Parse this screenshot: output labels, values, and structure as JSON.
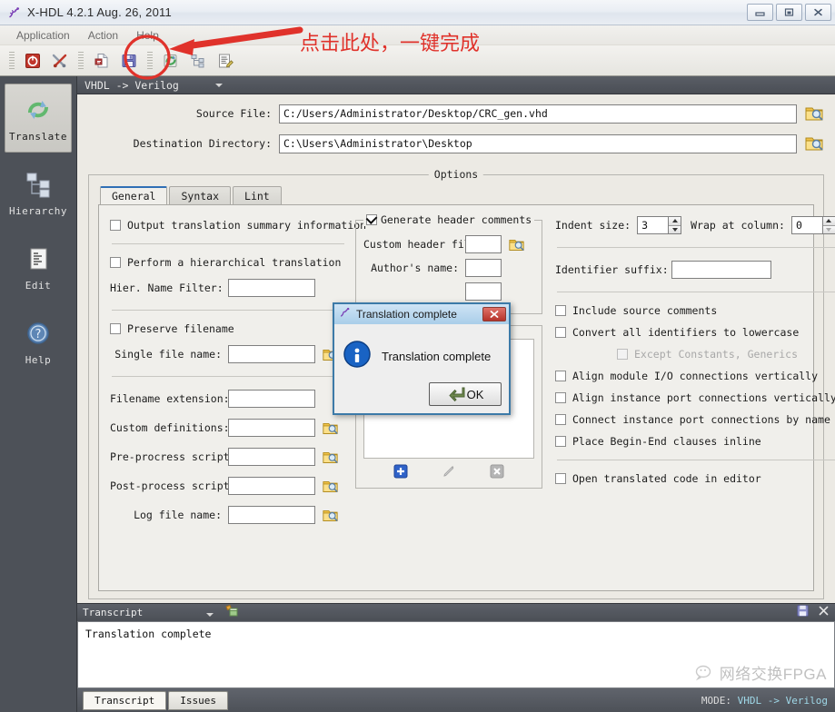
{
  "window": {
    "title": "X-HDL 4.2.1  Aug. 26, 2011",
    "app_icon": "gecko-icon",
    "minimize_label": "Minimize",
    "maximize_label": "Maximize",
    "close_label": "Close"
  },
  "menubar": {
    "items": [
      {
        "label": "Application"
      },
      {
        "label": "Action"
      },
      {
        "label": "Help"
      }
    ]
  },
  "toolbar": {
    "buttons": [
      {
        "name": "exit-icon",
        "title": "Exit"
      },
      {
        "name": "tools-icon",
        "title": "Tools"
      },
      {
        "name": "open-file-icon",
        "title": "Open"
      },
      {
        "name": "save-icon",
        "title": "Save"
      },
      {
        "name": "translate-icon",
        "title": "Translate"
      },
      {
        "name": "hierarchy-icon",
        "title": "Hierarchy"
      },
      {
        "name": "edit-icon",
        "title": "Edit"
      }
    ]
  },
  "sidebar": {
    "items": [
      {
        "label": "Translate",
        "icon": "translate-icon",
        "selected": true
      },
      {
        "label": "Hierarchy",
        "icon": "hierarchy-icon",
        "selected": false
      },
      {
        "label": "Edit",
        "icon": "edit-document-icon",
        "selected": false
      },
      {
        "label": "Help",
        "icon": "help-question-icon",
        "selected": false
      }
    ]
  },
  "mode_selector": {
    "value": "VHDL -> Verilog"
  },
  "form": {
    "source_file": {
      "label": "Source File:",
      "value": "C:/Users/Administrator/Desktop/CRC_gen.vhd",
      "browse_label": "Browse"
    },
    "destination_directory": {
      "label": "Destination Directory:",
      "value": "C:\\Users\\Administrator\\Desktop",
      "browse_label": "Browse"
    }
  },
  "options": {
    "group_title": "Options",
    "tabs": [
      {
        "label": "General",
        "active": true
      },
      {
        "label": "Syntax",
        "active": false
      },
      {
        "label": "Lint",
        "active": false
      }
    ],
    "left_column": {
      "checkboxes": [
        {
          "label": "Output translation summary information",
          "checked": false,
          "disabled": false
        },
        {
          "label": "Perform a hierarchical translation",
          "checked": false,
          "disabled": false
        },
        {
          "label": "Preserve filename",
          "checked": false,
          "disabled": false
        }
      ],
      "fields": [
        {
          "label": "Hier. Name Filter:",
          "value": "",
          "has_browse": false
        },
        {
          "label": "Single file name:",
          "value": "",
          "has_browse": true
        },
        {
          "label": "Filename extension:",
          "value": "",
          "has_browse": false
        },
        {
          "label": "Custom definitions:",
          "value": "",
          "has_browse": true
        },
        {
          "label": "Pre-procress script:",
          "value": "",
          "has_browse": true
        },
        {
          "label": "Post-process script:",
          "value": "",
          "has_browse": true
        },
        {
          "label": "Log file name:",
          "value": "",
          "has_browse": true
        }
      ]
    },
    "middle_column": {
      "group_checkbox": {
        "label": "Generate header comments",
        "checked": true
      },
      "fields": [
        {
          "label": "Custom header file:",
          "value": "",
          "has_browse": true
        },
        {
          "label": "Author's name:",
          "value": "",
          "has_browse": false
        }
      ],
      "list_items": [],
      "list_tools": [
        {
          "name": "add-icon",
          "label": "Add"
        },
        {
          "name": "edit-pencil-icon",
          "label": "Edit"
        },
        {
          "name": "delete-icon",
          "label": "Delete"
        }
      ]
    },
    "right_column": {
      "indent_size": {
        "label": "Indent size:",
        "value": "3"
      },
      "wrap_at_column": {
        "label": "Wrap at column:",
        "value": "0"
      },
      "identifier_suffix": {
        "label": "Identifier suffix:",
        "value": ""
      },
      "checkboxes": [
        {
          "label": "Include source comments",
          "checked": false,
          "disabled": false,
          "indent": false
        },
        {
          "label": "Convert all identifiers to lowercase",
          "checked": false,
          "disabled": false,
          "indent": false
        },
        {
          "label": "Except Constants, Generics",
          "checked": false,
          "disabled": true,
          "indent": true
        },
        {
          "label": "Align module I/O connections vertically",
          "checked": false,
          "disabled": false,
          "indent": false
        },
        {
          "label": "Align instance port connections vertically",
          "checked": false,
          "disabled": false,
          "indent": false
        },
        {
          "label": "Connect instance port connections by name",
          "checked": false,
          "disabled": false,
          "indent": false
        },
        {
          "label": "Place Begin-End clauses inline",
          "checked": false,
          "disabled": false,
          "indent": false
        },
        {
          "label": "Open translated code in editor",
          "checked": false,
          "disabled": false,
          "indent": false
        }
      ]
    }
  },
  "transcript": {
    "selector_value": "Transcript",
    "clear_icon": "clear-brush-icon",
    "save_icon": "save-icon",
    "close_icon": "close-icon",
    "lines": [
      "Translation complete"
    ],
    "watermark": "网络交换FPGA",
    "tabs": [
      {
        "label": "Transcript",
        "active": true
      },
      {
        "label": "Issues",
        "active": false
      }
    ],
    "status_key": "MODE:",
    "status_value": "VHDL -> Verilog"
  },
  "dialog": {
    "title": "Translation complete",
    "icon": "gecko-icon",
    "info_icon": "info-icon",
    "message": "Translation complete",
    "ok_label": "OK",
    "close_label": "Close"
  },
  "annotation": {
    "text": "点击此处，一键完成",
    "color": "#e0322b"
  }
}
